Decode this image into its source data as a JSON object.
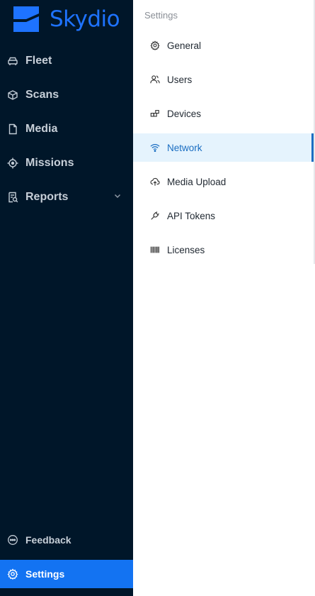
{
  "brand": {
    "name": "Skydio",
    "color": "#1e73ff"
  },
  "sidebar": {
    "items": [
      {
        "label": "Fleet",
        "icon": "car-icon"
      },
      {
        "label": "Scans",
        "icon": "cube-icon"
      },
      {
        "label": "Media",
        "icon": "file-icon"
      },
      {
        "label": "Missions",
        "icon": "target-icon"
      },
      {
        "label": "Reports",
        "icon": "report-icon",
        "expandable": true
      }
    ],
    "bottom": [
      {
        "label": "Feedback",
        "icon": "chat-icon"
      },
      {
        "label": "Settings",
        "icon": "gear-icon",
        "active": true
      }
    ]
  },
  "settings": {
    "title": "Settings",
    "items": [
      {
        "label": "General",
        "icon": "gear-icon"
      },
      {
        "label": "Users",
        "icon": "users-icon"
      },
      {
        "label": "Devices",
        "icon": "devices-icon"
      },
      {
        "label": "Network",
        "icon": "wifi-icon",
        "active": true
      },
      {
        "label": "Media Upload",
        "icon": "cloud-upload-icon"
      },
      {
        "label": "API Tokens",
        "icon": "plug-icon"
      },
      {
        "label": "Licenses",
        "icon": "barcode-icon"
      }
    ]
  },
  "colors": {
    "sidebar_bg": "#001629",
    "active_nav": "#1373f2",
    "active_setting_bg": "#e5f3fd",
    "active_setting_text": "#1b6ec2"
  }
}
